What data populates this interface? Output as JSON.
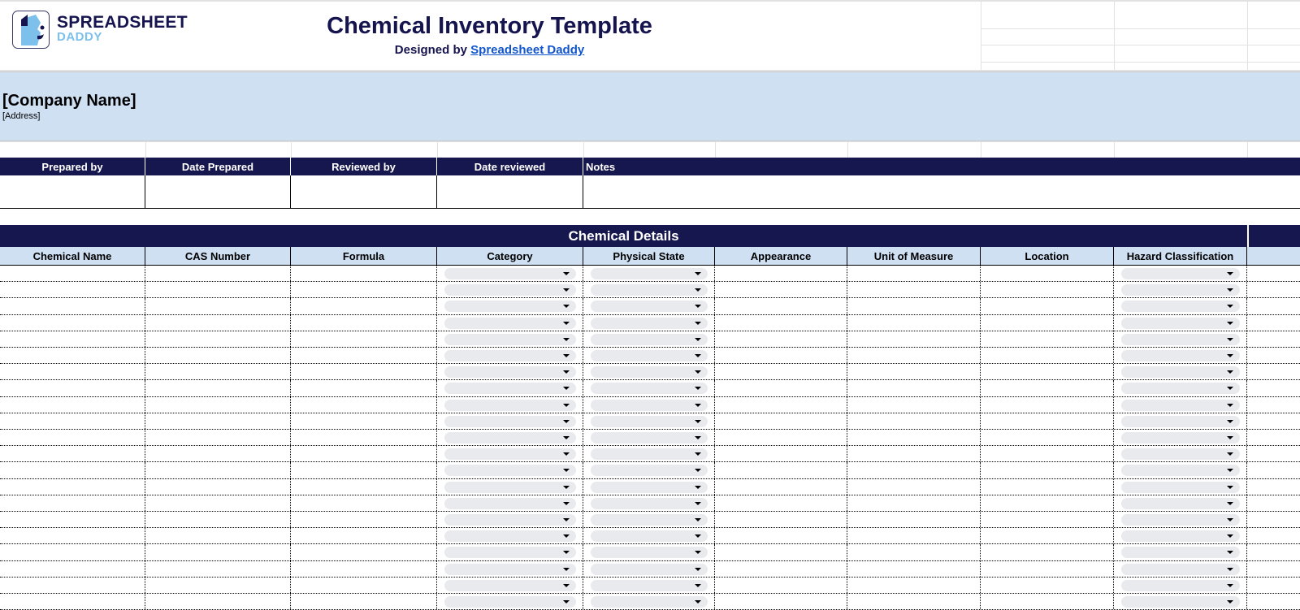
{
  "brand": {
    "line1": "SPREADSHEET",
    "line2": "DADDY"
  },
  "header": {
    "title": "Chemical Inventory Template",
    "designed_by": "Designed by",
    "designer_link": "Spreadsheet Daddy"
  },
  "company": {
    "name": "[Company Name]",
    "address": "[Address]"
  },
  "prep_headers": [
    "Prepared by",
    "Date Prepared",
    "Reviewed by",
    "Date reviewed",
    "Notes"
  ],
  "section_title": "Chemical Details",
  "columns": [
    "Chemical Name",
    "CAS Number",
    "Formula",
    "Category",
    "Physical State",
    "Appearance",
    "Unit of Measure",
    "Location",
    "Hazard Classification"
  ],
  "dropdown_columns": [
    "Category",
    "Physical State",
    "Hazard Classification"
  ],
  "colors": {
    "navy": "#17174f",
    "light_blue": "#cfe0f3",
    "link": "#1155cc",
    "brand_light": "#7dc0ec"
  }
}
